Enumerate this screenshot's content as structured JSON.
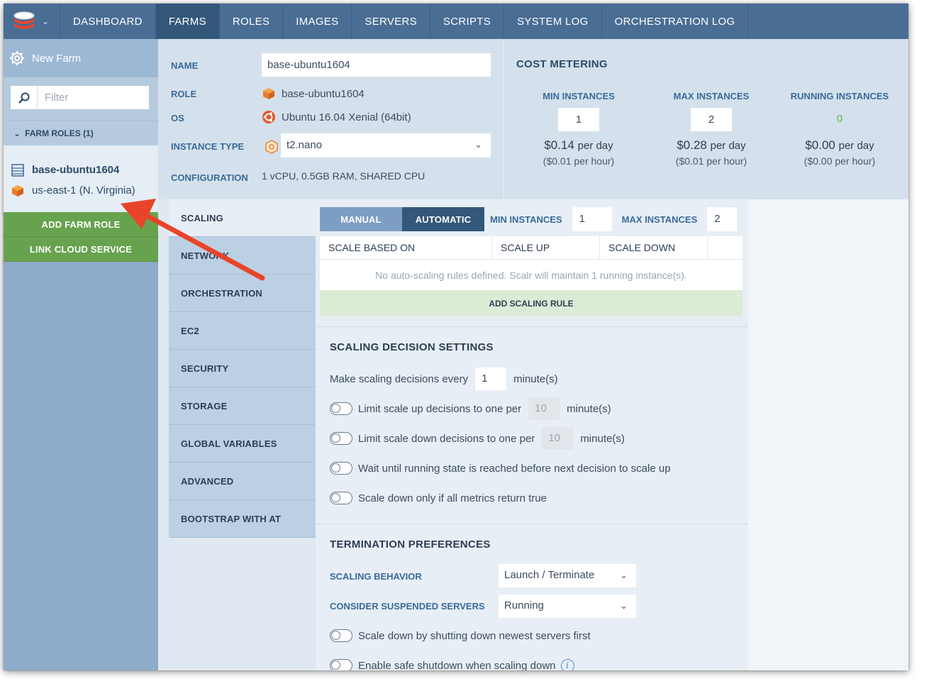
{
  "nav": {
    "items": [
      "DASHBOARD",
      "FARMS",
      "ROLES",
      "IMAGES",
      "SERVERS",
      "SCRIPTS",
      "SYSTEM LOG",
      "ORCHESTRATION LOG"
    ],
    "active": "FARMS"
  },
  "sidebar": {
    "new_farm": "New Farm",
    "filter_placeholder": "Filter",
    "farm_roles_header": "FARM ROLES (1)",
    "role_name": "base-ubuntu1604",
    "role_region": "us-east-1 (N. Virginia)",
    "add_farm_role": "ADD FARM ROLE",
    "link_cloud_service": "LINK CLOUD SERVICE"
  },
  "role_info": {
    "name_label": "NAME",
    "name_value": "base-ubuntu1604",
    "role_label": "ROLE",
    "role_value": "base-ubuntu1604",
    "os_label": "OS",
    "os_value": "Ubuntu 16.04 Xenial (64bit)",
    "instance_type_label": "INSTANCE TYPE",
    "instance_type_value": "t2.nano",
    "configuration_label": "CONFIGURATION",
    "configuration_value": "1 vCPU, 0.5GB RAM, SHARED CPU"
  },
  "cost": {
    "title": "COST METERING",
    "min": {
      "label": "MIN INSTANCES",
      "value": "1",
      "price": "$0.14",
      "per_day": "per day",
      "hour": "($0.01 per hour)"
    },
    "max": {
      "label": "MAX INSTANCES",
      "value": "2",
      "price": "$0.28",
      "per_day": "per day",
      "hour": "($0.01 per hour)"
    },
    "running": {
      "label": "RUNNING INSTANCES",
      "value": "0",
      "price": "$0.00",
      "per_day": "per day",
      "hour": "($0.00 per hour)"
    }
  },
  "tabs": [
    "SCALING",
    "NETWORK",
    "ORCHESTRATION",
    "EC2",
    "SECURITY",
    "STORAGE",
    "GLOBAL VARIABLES",
    "ADVANCED",
    "BOOTSTRAP WITH AT"
  ],
  "scaling": {
    "manual": "MANUAL",
    "automatic": "AUTOMATIC",
    "min_label": "MIN INSTANCES",
    "min_value": "1",
    "max_label": "MAX INSTANCES",
    "max_value": "2",
    "columns": [
      "SCALE BASED ON",
      "SCALE UP",
      "SCALE DOWN"
    ],
    "empty": "No auto-scaling rules defined. Scalr will maintain 1 running instance(s).",
    "add_rule": "ADD SCALING RULE"
  },
  "decision": {
    "title": "SCALING DECISION SETTINGS",
    "every_prefix": "Make scaling decisions every",
    "every_value": "1",
    "minutes": "minute(s)",
    "limit_up": "Limit scale up decisions to one per",
    "limit_up_value": "10",
    "limit_down": "Limit scale down decisions to one per",
    "limit_down_value": "10",
    "wait_running": "Wait until running state is reached before next decision to scale up",
    "scale_down_all": "Scale down only if all metrics return true"
  },
  "termination": {
    "title": "TERMINATION PREFERENCES",
    "behavior_label": "SCALING BEHAVIOR",
    "behavior_value": "Launch / Terminate",
    "suspended_label": "CONSIDER SUSPENDED SERVERS",
    "suspended_value": "Running",
    "newest_first": "Scale down by shutting down newest servers first",
    "safe_shutdown": "Enable safe shutdown when scaling down"
  },
  "colors": {
    "nav": "#4a6d94",
    "nav_active": "#335879",
    "green_button": "#67a34f",
    "annotation_arrow": "#e8442a"
  }
}
